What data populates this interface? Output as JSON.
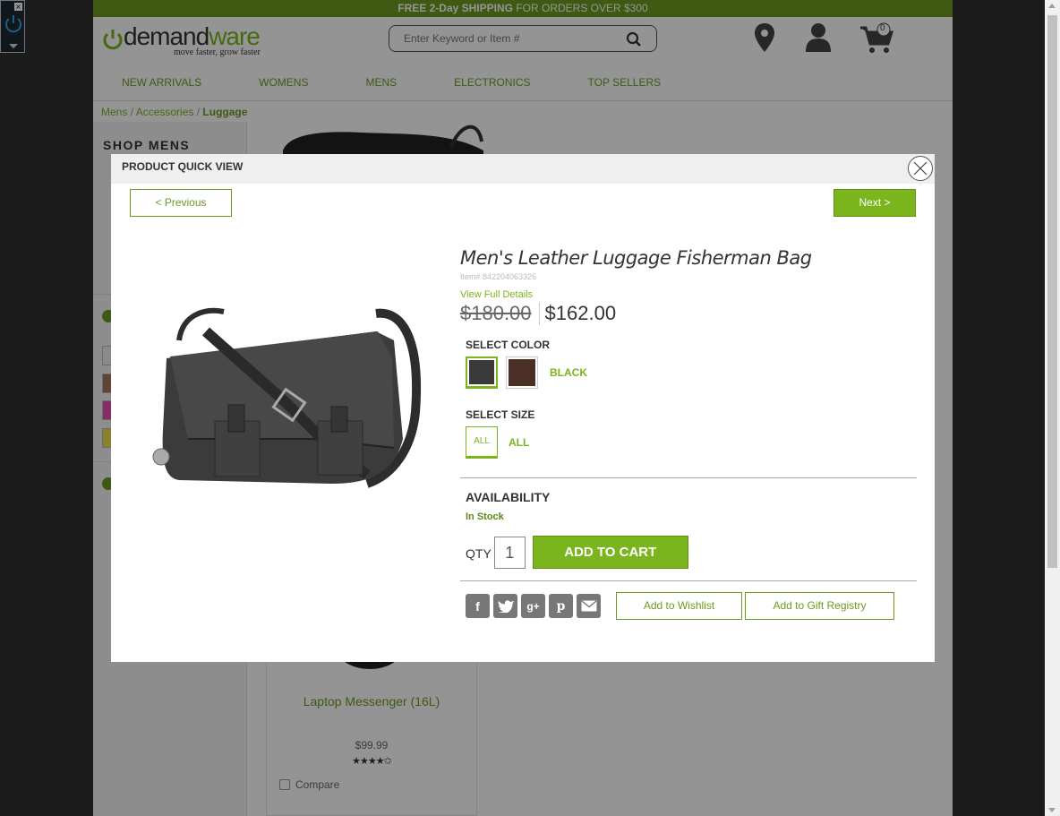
{
  "promo": {
    "bold": "FREE 2-Day SHIPPING",
    "light": " FOR ORDERS OVER $300"
  },
  "logo": {
    "word_a": "demand",
    "word_b": "ware",
    "tagline": "move faster, grow faster"
  },
  "search": {
    "placeholder": "Enter Keyword or Item #"
  },
  "cart": {
    "count": "0"
  },
  "nav": [
    "NEW ARRIVALS",
    "WOMENS",
    "MENS",
    "ELECTRONICS",
    "TOP SELLERS"
  ],
  "breadcrumb": {
    "a": "Mens",
    "sep": "/",
    "b": "Accessories",
    "c": "Luggage"
  },
  "sidebar": {
    "title": "SHOP MENS"
  },
  "bg_tile": {
    "name": "Laptop Messenger (16L)",
    "price": "$99.99",
    "stars": "★★★★✩",
    "compare": "Compare"
  },
  "modal": {
    "title": "PRODUCT QUICK VIEW",
    "prev": "< Previous",
    "next": "Next >",
    "product_name": "Men's Leather Luggage Fisherman Bag",
    "item": "Item# 842204063326",
    "view_details": "View Full Details",
    "old_price": "$180.00",
    "new_price": "$162.00",
    "select_color": "SELECT COLOR",
    "colors": [
      {
        "hex": "#3a3a3a"
      },
      {
        "hex": "#4a2f26"
      }
    ],
    "selected_color": "BLACK",
    "select_size": "SELECT SIZE",
    "size_swatch": "ALL",
    "selected_size": "ALL",
    "availability_label": "AVAILABILITY",
    "availability": "In Stock",
    "qty_label": "QTY",
    "qty": "1",
    "add_to_cart": "ADD TO CART",
    "share_icons": [
      "facebook-icon",
      "twitter-icon",
      "google-plus-icon",
      "pinterest-icon",
      "email-icon"
    ],
    "wishlist": "Add to Wishlist",
    "registry": "Add to Gift Registry"
  },
  "colors": {
    "accent": "#7ab51d",
    "accent_dark": "#6b9b1f"
  }
}
